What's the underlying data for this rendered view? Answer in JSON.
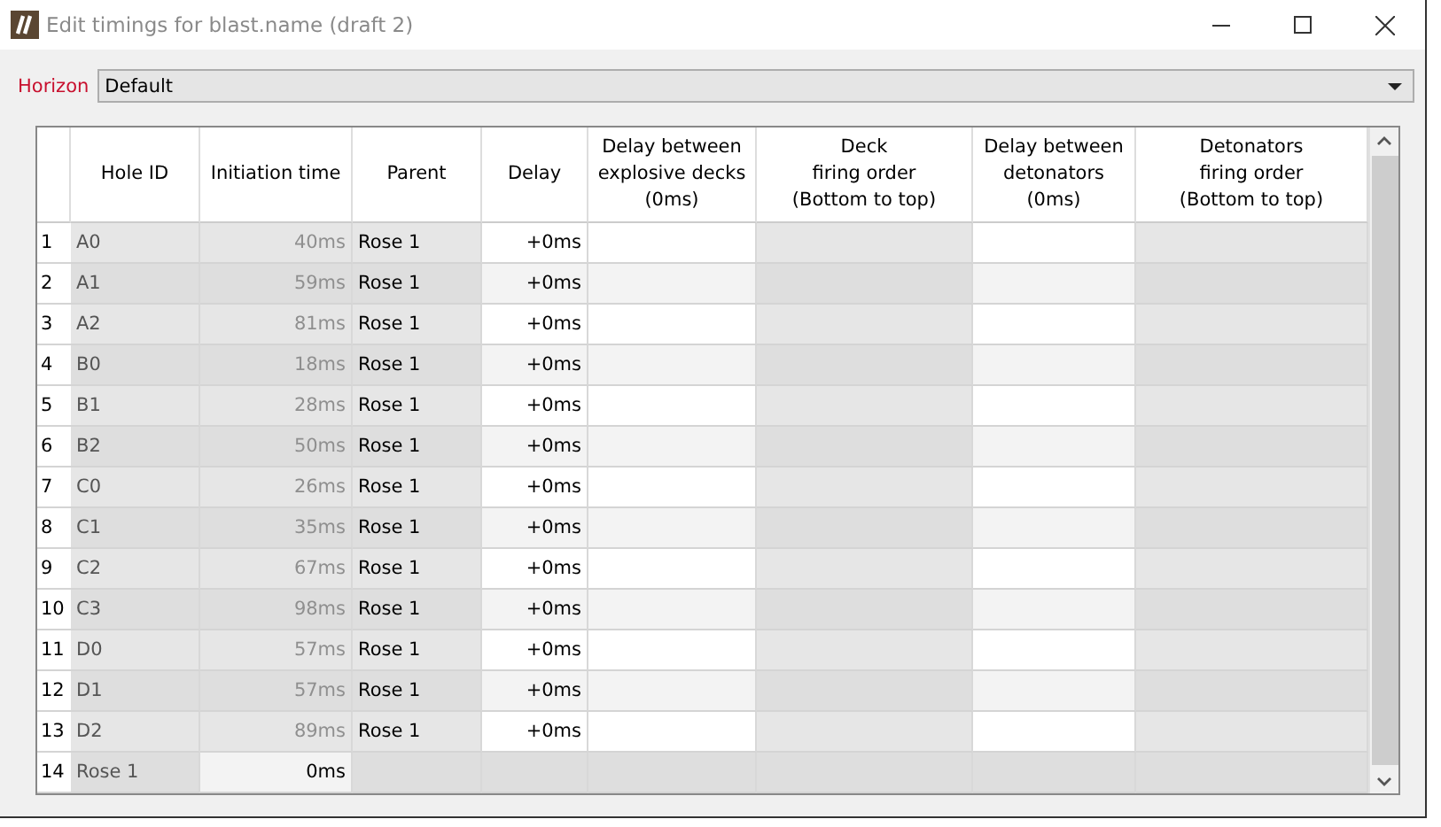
{
  "window": {
    "title": "Edit timings for blast.name (draft 2)"
  },
  "horizon": {
    "label": "Horizon",
    "value": "Default"
  },
  "table": {
    "columns": [
      "Hole ID",
      "Initiation time",
      "Parent",
      "Delay",
      "Delay between\nexplosive decks\n(0ms)",
      "Deck\nfiring order\n(Bottom to top)",
      "Delay between\ndetonators\n(0ms)",
      "Detonators\nfiring order\n(Bottom to top)"
    ],
    "rows": [
      {
        "number": "1",
        "kind": "hole",
        "hole_id": "A0",
        "initiation_time": "40ms",
        "parent": "Rose 1",
        "delay": "+0ms"
      },
      {
        "number": "2",
        "kind": "hole",
        "hole_id": "A1",
        "initiation_time": "59ms",
        "parent": "Rose 1",
        "delay": "+0ms"
      },
      {
        "number": "3",
        "kind": "hole",
        "hole_id": "A2",
        "initiation_time": "81ms",
        "parent": "Rose 1",
        "delay": "+0ms"
      },
      {
        "number": "4",
        "kind": "hole",
        "hole_id": "B0",
        "initiation_time": "18ms",
        "parent": "Rose 1",
        "delay": "+0ms"
      },
      {
        "number": "5",
        "kind": "hole",
        "hole_id": "B1",
        "initiation_time": "28ms",
        "parent": "Rose 1",
        "delay": "+0ms"
      },
      {
        "number": "6",
        "kind": "hole",
        "hole_id": "B2",
        "initiation_time": "50ms",
        "parent": "Rose 1",
        "delay": "+0ms"
      },
      {
        "number": "7",
        "kind": "hole",
        "hole_id": "C0",
        "initiation_time": "26ms",
        "parent": "Rose 1",
        "delay": "+0ms"
      },
      {
        "number": "8",
        "kind": "hole",
        "hole_id": "C1",
        "initiation_time": "35ms",
        "parent": "Rose 1",
        "delay": "+0ms"
      },
      {
        "number": "9",
        "kind": "hole",
        "hole_id": "C2",
        "initiation_time": "67ms",
        "parent": "Rose 1",
        "delay": "+0ms"
      },
      {
        "number": "10",
        "kind": "hole",
        "hole_id": "C3",
        "initiation_time": "98ms",
        "parent": "Rose 1",
        "delay": "+0ms"
      },
      {
        "number": "11",
        "kind": "hole",
        "hole_id": "D0",
        "initiation_time": "57ms",
        "parent": "Rose 1",
        "delay": "+0ms"
      },
      {
        "number": "12",
        "kind": "hole",
        "hole_id": "D1",
        "initiation_time": "57ms",
        "parent": "Rose 1",
        "delay": "+0ms"
      },
      {
        "number": "13",
        "kind": "hole",
        "hole_id": "D2",
        "initiation_time": "89ms",
        "parent": "Rose 1",
        "delay": "+0ms"
      },
      {
        "number": "14",
        "kind": "root",
        "hole_id": "Rose 1",
        "initiation_time": "0ms"
      }
    ]
  }
}
